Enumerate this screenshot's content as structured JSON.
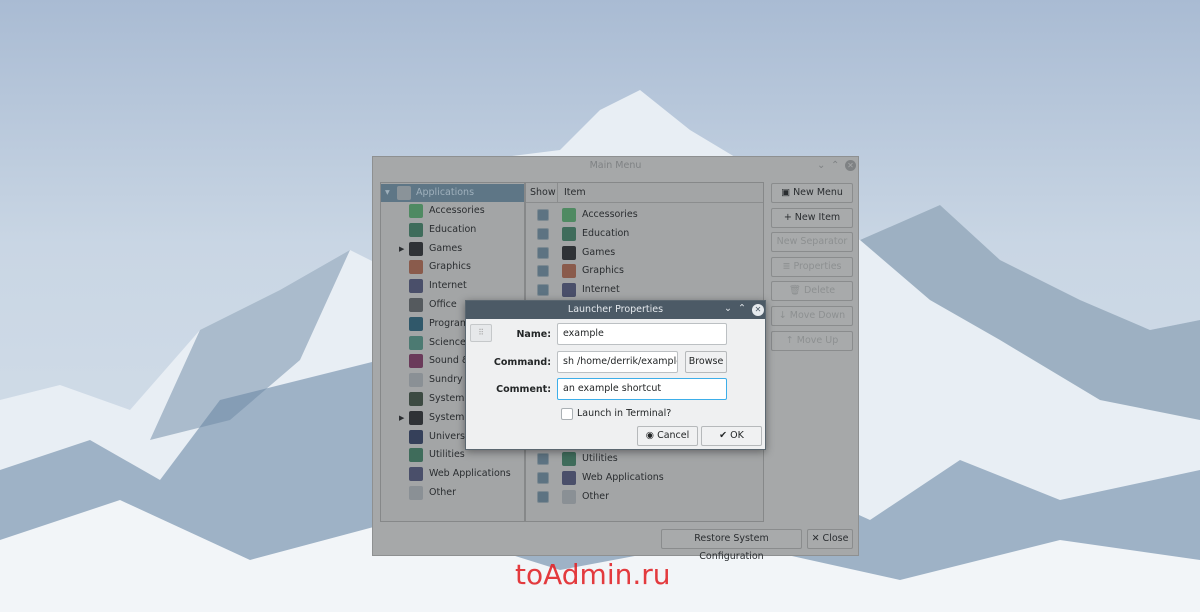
{
  "main_window": {
    "title": "Main Menu",
    "controls": [
      "⌄",
      "⌃",
      "✕"
    ],
    "tree": {
      "root": "Applications",
      "items": [
        {
          "label": "Accessories",
          "icon": "accessories-icon",
          "color": "#4f8a62"
        },
        {
          "label": "Education",
          "icon": "education-icon",
          "color": "#3f6c5b"
        },
        {
          "label": "Games",
          "icon": "gamepad-icon",
          "color": "#2f3236",
          "expandable": true
        },
        {
          "label": "Graphics",
          "icon": "graphics-icon",
          "color": "#8a5b4c"
        },
        {
          "label": "Internet",
          "icon": "compass-icon",
          "color": "#4a4f6a"
        },
        {
          "label": "Office",
          "icon": "document-icon",
          "color": "#555a5e"
        },
        {
          "label": "Programming",
          "icon": "gear-circle-icon",
          "color": "#30586a"
        },
        {
          "label": "Science",
          "icon": "atom-icon",
          "color": "#4c7a72"
        },
        {
          "label": "Sound & Video",
          "icon": "play-icon",
          "color": "#6a3a5a"
        },
        {
          "label": "Sundry",
          "icon": "folder-download-icon",
          "color": "#8a9095"
        },
        {
          "label": "System Settings",
          "icon": "settings-icon",
          "color": "#3c4a42"
        },
        {
          "label": "System Tools",
          "icon": "cog-icon",
          "color": "#2f3236",
          "expandable": true
        },
        {
          "label": "Universal Access",
          "icon": "accessibility-icon",
          "color": "#35405a"
        },
        {
          "label": "Utilities",
          "icon": "utilities-icon",
          "color": "#3f6c5b"
        },
        {
          "label": "Web Applications",
          "icon": "compass-icon",
          "color": "#4a4f6a"
        },
        {
          "label": "Other",
          "icon": "folder-download-icon",
          "color": "#8a9095"
        }
      ]
    },
    "list": {
      "col_show": "Show",
      "col_item": "Item",
      "top_items": [
        {
          "label": "Accessories",
          "color": "#4f8a62"
        },
        {
          "label": "Education",
          "color": "#3f6c5b"
        },
        {
          "label": "Games",
          "color": "#2f3236"
        },
        {
          "label": "Graphics",
          "color": "#8a5b4c"
        },
        {
          "label": "Internet",
          "color": "#4a4f6a"
        }
      ],
      "bottom_items": [
        {
          "label": "Utilities",
          "color": "#3f6c5b"
        },
        {
          "label": "Web Applications",
          "color": "#4a4f6a"
        },
        {
          "label": "Other",
          "color": "#8a9095"
        }
      ]
    },
    "buttons": [
      {
        "label": "New Menu",
        "icon": "new-menu-icon",
        "glyph": "▣",
        "enabled": true
      },
      {
        "label": "New Item",
        "icon": "plus-icon",
        "glyph": "+",
        "enabled": true
      },
      {
        "label": "New Separator",
        "icon": "",
        "glyph": "",
        "enabled": false
      },
      {
        "label": "Properties",
        "icon": "list-icon",
        "glyph": "≣",
        "enabled": false
      },
      {
        "label": "Delete",
        "icon": "trash-icon",
        "glyph": "🗑",
        "enabled": false
      },
      {
        "label": "Move Down",
        "icon": "arrow-down-icon",
        "glyph": "↓",
        "enabled": false
      },
      {
        "label": "Move Up",
        "icon": "arrow-up-icon",
        "glyph": "↑",
        "enabled": false
      }
    ],
    "restore_label": "Restore System Configuration",
    "close_label": "✕ Close"
  },
  "dialog": {
    "title": "Launcher Properties",
    "controls": [
      "⌄",
      "⌃",
      "✕"
    ],
    "name_label": "Name:",
    "name_value": "example",
    "command_label": "Command:",
    "command_value": "sh /home/derrik/example",
    "browse_label": "Browse",
    "comment_label": "Comment:",
    "comment_value": "an example shortcut",
    "terminal_label": "Launch in Terminal?",
    "terminal_checked": false,
    "cancel_label": "Cancel",
    "ok_label": "OK"
  },
  "watermark": "toAdmin.ru"
}
